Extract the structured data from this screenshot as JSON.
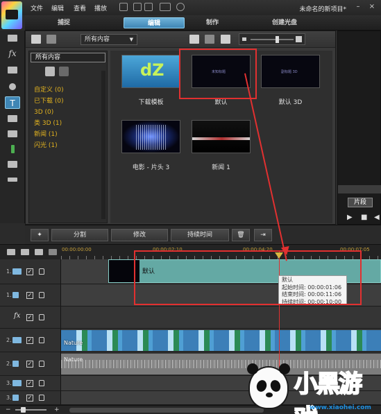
{
  "menu": {
    "items": [
      "文件",
      "编辑",
      "查看",
      "播放"
    ],
    "project_title": "未命名的新项目*"
  },
  "modes": [
    "捕捉",
    "编辑",
    "制作",
    "创建光盘"
  ],
  "active_mode": "编辑",
  "library": {
    "dropdown_value": "所有内容",
    "category_header": "所有内容",
    "categories": [
      "自定义 (0)",
      "已下载 (0)",
      "3D (0)",
      "类 3D (1)",
      "新闻 (1)",
      "闪光 (1)"
    ],
    "templates": [
      {
        "label": "下载模板",
        "thumb_text": "dZ"
      },
      {
        "label": "默认",
        "thumb_text": "未知标题"
      },
      {
        "label": "默认 3D",
        "thumb_text": "副标题 3D"
      },
      {
        "label": "电影 - 片头 3",
        "thumb_text": ""
      },
      {
        "label": "新闻 1",
        "thumb_text": ""
      }
    ]
  },
  "preview": {
    "segment_tab": "片段"
  },
  "edit_toolbar": {
    "split": "分割",
    "modify": "修改",
    "duration": "持续时间"
  },
  "timeline": {
    "timecodes": [
      "00:00:00:00",
      "00:00:02:10",
      "00:00:04:20",
      "00:00:07:05"
    ],
    "tracks": [
      {
        "num": "1.",
        "type": "video"
      },
      {
        "num": "1.",
        "type": "audio"
      },
      {
        "num": "",
        "type": "fx",
        "label": "fx"
      },
      {
        "num": "2.",
        "type": "video"
      },
      {
        "num": "2.",
        "type": "audio"
      },
      {
        "num": "3.",
        "type": "video"
      },
      {
        "num": "3.",
        "type": "audio"
      }
    ],
    "title_clip_label": "默认",
    "video_clip_label": "Nature",
    "audio_clip_label": "Nature"
  },
  "tooltip": {
    "title": "默认",
    "start": "起始时间: 00:00:01:06",
    "end": "结束时间: 00:00:11:06",
    "duration": "持续时间: 00:00:10:00"
  },
  "watermark": {
    "brand": "小黑游戏",
    "url": "www.xiaohei.com"
  },
  "colors": {
    "accent": "#3f86b5",
    "highlight_box": "#e23030",
    "category_text": "#e3b31f",
    "title_clip": "#64a9a4"
  }
}
